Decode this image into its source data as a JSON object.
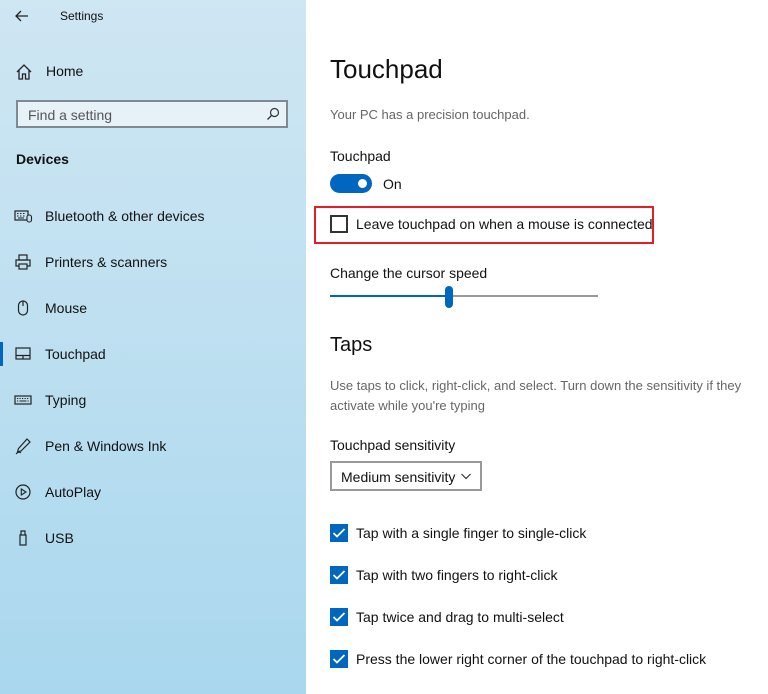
{
  "window": {
    "title": "Settings"
  },
  "sidebar": {
    "home_label": "Home",
    "search": {
      "placeholder": "Find a setting"
    },
    "section_title": "Devices",
    "items": [
      {
        "label": "Bluetooth & other devices",
        "icon": "bluetooth-devices-icon"
      },
      {
        "label": "Printers & scanners",
        "icon": "printer-icon"
      },
      {
        "label": "Mouse",
        "icon": "mouse-icon"
      },
      {
        "label": "Touchpad",
        "icon": "touchpad-icon",
        "active": true
      },
      {
        "label": "Typing",
        "icon": "keyboard-icon"
      },
      {
        "label": "Pen & Windows Ink",
        "icon": "pen-icon"
      },
      {
        "label": "AutoPlay",
        "icon": "autoplay-icon"
      },
      {
        "label": "USB",
        "icon": "usb-icon"
      }
    ]
  },
  "main": {
    "title": "Touchpad",
    "subtitle": "Your PC has a precision touchpad.",
    "touchpad_label": "Touchpad",
    "toggle": {
      "state": "On",
      "on": true
    },
    "leave_on": {
      "label": "Leave touchpad on when a mouse is connected",
      "checked": false
    },
    "cursor_speed": {
      "label": "Change the cursor speed",
      "value_fraction": 0.44
    },
    "taps": {
      "heading": "Taps",
      "description": "Use taps to click, right-click, and select. Turn down the sensitivity if they activate while you're typing",
      "sensitivity_label": "Touchpad sensitivity",
      "sensitivity_value": "Medium sensitivity",
      "options": [
        {
          "label": "Tap with a single finger to single-click",
          "checked": true
        },
        {
          "label": "Tap with two fingers to right-click",
          "checked": true
        },
        {
          "label": "Tap twice and drag to multi-select",
          "checked": true
        },
        {
          "label": "Press the lower right corner of the touchpad to right-click",
          "checked": true
        }
      ]
    }
  },
  "colors": {
    "accent": "#0067c0",
    "highlight": "#e31e24",
    "sidebar_bg": "#bfe0f1"
  }
}
